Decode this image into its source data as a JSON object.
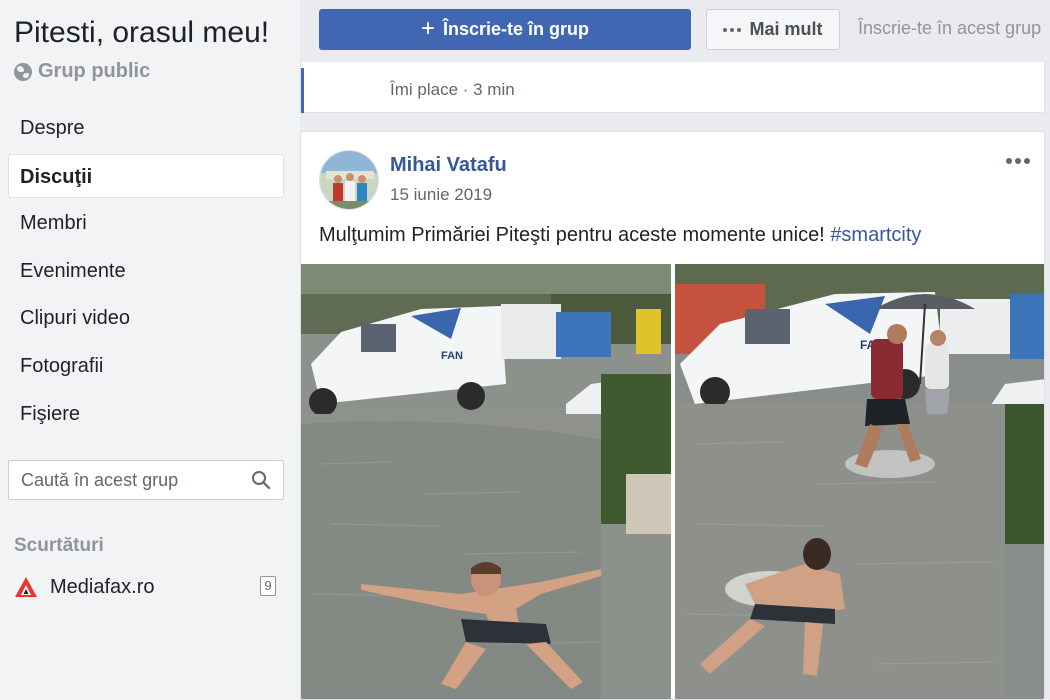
{
  "group": {
    "title": "Pitesti, orasul meu!",
    "type": "Grup public"
  },
  "nav": {
    "items": [
      {
        "label": "Despre",
        "active": false
      },
      {
        "label": "Discuţii",
        "active": true
      },
      {
        "label": "Membri",
        "active": false
      },
      {
        "label": "Evenimente",
        "active": false
      },
      {
        "label": "Clipuri video",
        "active": false
      },
      {
        "label": "Fotografii",
        "active": false
      },
      {
        "label": "Fişiere",
        "active": false
      }
    ]
  },
  "search": {
    "placeholder": "Caută în acest grup",
    "icon": "search-icon"
  },
  "shortcuts": {
    "title": "Scurtături",
    "items": [
      {
        "label": "Mediafax.ro",
        "badge": "9",
        "icon": "mediafax-logo"
      }
    ]
  },
  "actions": {
    "join_label": "Înscrie-te în grup",
    "more_label": "Mai mult",
    "join_hint": "Înscrie-te în acest grup"
  },
  "previous_post": {
    "meta": "Îmi place · 3 min"
  },
  "post": {
    "author": "Mihai Vatafu",
    "date": "15 iunie 2019",
    "text": "Mulţumim Primăriei Piteşti pentru aceste momente unice! ",
    "hashtag": "#smartcity"
  },
  "colors": {
    "brand": "#4267b2",
    "link": "#365899",
    "sidebar_bg": "#f2f3f5",
    "page_bg": "#e9ebee"
  }
}
